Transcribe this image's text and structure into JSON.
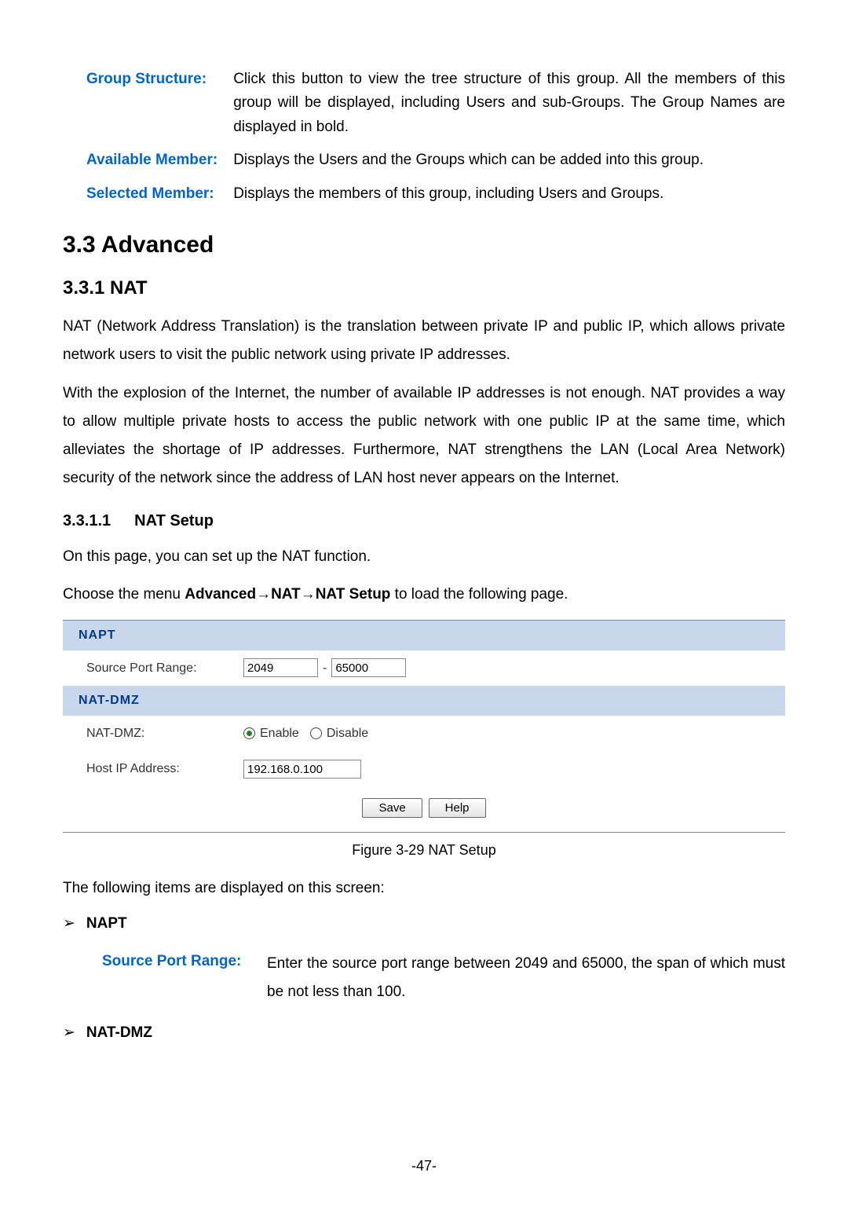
{
  "defs": {
    "group_structure": {
      "term": "Group Structure:",
      "desc": "Click this button to view the tree structure of this group. All the members of this group will be displayed, including Users and sub-Groups. The Group Names are displayed in bold."
    },
    "available_member": {
      "term": "Available Member:",
      "desc": "Displays the Users and the Groups which can be added into this group."
    },
    "selected_member": {
      "term": "Selected Member:",
      "desc": "Displays the members of this group, including Users and Groups."
    }
  },
  "headings": {
    "advanced": "3.3  Advanced",
    "nat": "3.3.1   NAT",
    "nat_setup_num": "3.3.1.1",
    "nat_setup_label": "NAT Setup"
  },
  "paras": {
    "nat_intro": "NAT (Network Address Translation) is the translation between private IP and public IP, which allows private network users to visit the public network using private IP addresses.",
    "nat_expl": "With the explosion of the Internet, the number of available IP addresses is not enough. NAT provides a way to allow multiple private hosts to access the public network with one public IP at the same time, which alleviates the shortage of IP addresses. Furthermore, NAT strengthens the LAN (Local Area Network) security of the network since the address of LAN host never appears on the Internet.",
    "nat_setup_intro": "On this page, you can set up the NAT function.",
    "menu_pre": "Choose the menu ",
    "menu_bold": "Advanced→NAT→NAT Setup",
    "menu_post": " to load the following page."
  },
  "figure": {
    "napt_header": "NAPT",
    "src_port_label": "Source Port Range:",
    "src_port_from": "2049",
    "src_port_to": "65000",
    "natdmz_header": "NAT-DMZ",
    "natdmz_label": "NAT-DMZ:",
    "enable": "Enable",
    "disable": "Disable",
    "host_ip_label": "Host IP Address:",
    "host_ip": "192.168.0.100",
    "save": "Save",
    "help": "Help",
    "caption": "Figure 3-29 NAT Setup"
  },
  "items_intro": "The following items are displayed on this screen:",
  "bullets": {
    "napt": "NAPT",
    "natdmz": "NAT-DMZ"
  },
  "subdef": {
    "term": "Source Port Range:",
    "desc": "Enter the source port range between 2049 and 65000, the span of which must be not less than 100."
  },
  "page_number": "-47-"
}
